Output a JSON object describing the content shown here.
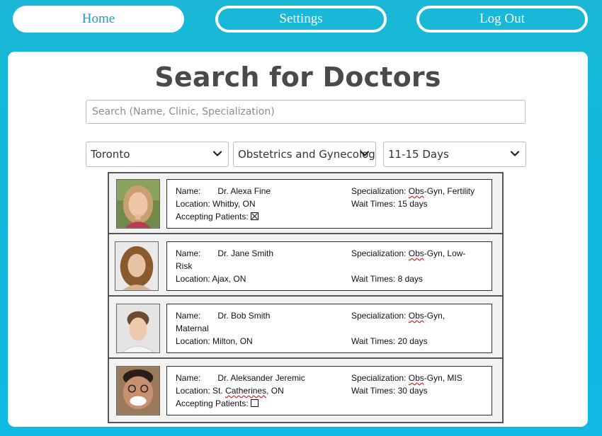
{
  "nav": {
    "home_label": "Home",
    "settings_label": "Settings",
    "logout_label": "Log Out"
  },
  "page": {
    "title": "Search for Doctors"
  },
  "search": {
    "placeholder": "Search (Name, Clinic, Specialization)",
    "value": ""
  },
  "filters": {
    "city": "Toronto",
    "specialization": "Obstetrics and Gynecology",
    "wait_time": "11-15 Days"
  },
  "labels": {
    "name": "Name:",
    "location": "Location:",
    "specialization": "Specialization:",
    "wait_times": "Wait Times:",
    "accepting": "Accepting Patients:"
  },
  "doctors": [
    {
      "name": "Dr. Alexa Fine",
      "location": "Whitby, ON",
      "spec_flagged": "Obs",
      "spec_rest": "-Gyn, Fertility",
      "wait": "15 days",
      "accepting": true
    },
    {
      "name": "Dr. Jane Smith",
      "name_suffix": "Risk",
      "location": "Ajax, ON",
      "spec_flagged": "Obs",
      "spec_rest": "-Gyn, Low-",
      "wait": "8 days"
    },
    {
      "name": "Dr. Bob Smith",
      "name_suffix": "Maternal",
      "location": "Milton, ON",
      "spec_flagged": "Obs",
      "spec_rest": "-Gyn,",
      "wait": "20 days"
    },
    {
      "name": "Dr. Aleksander Jeremic",
      "location_flagged": "Catherines",
      "location_prefix": "St.",
      "location_suffix": ", ON",
      "spec_flagged": "Obs",
      "spec_rest": "-Gyn, MIS",
      "wait": "30 days",
      "accepting": false
    }
  ],
  "colors": {
    "background": "#10b7dc",
    "title_text": "#4a4a4a",
    "home_text": "#1a9fc9"
  }
}
